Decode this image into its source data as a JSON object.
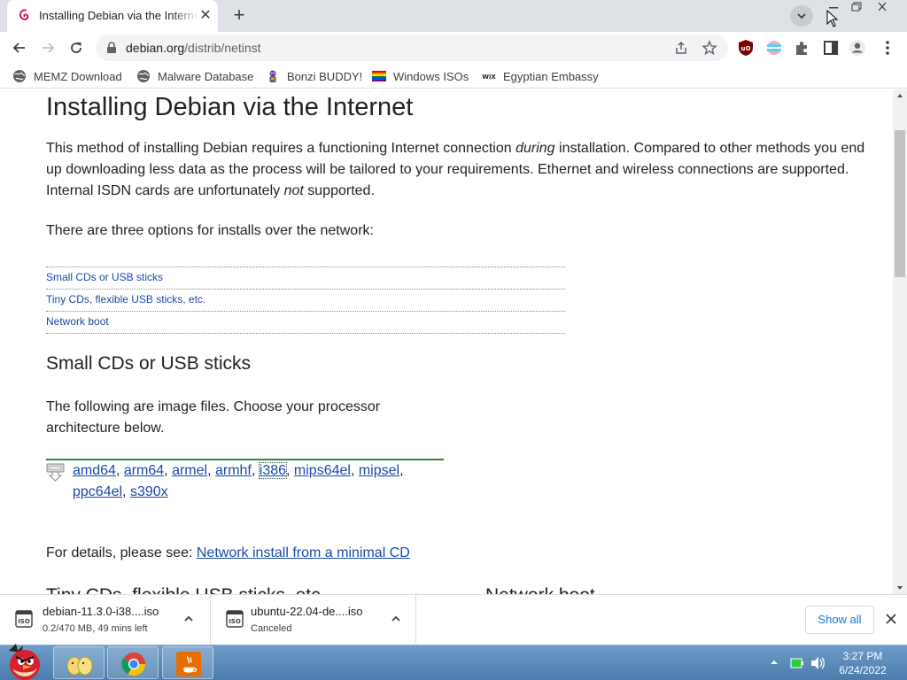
{
  "browser": {
    "tab": {
      "title": "Installing Debian via the Internet",
      "close": "✕"
    },
    "new_tab": "+",
    "url": {
      "host": "debian.org",
      "path": "/distrib/netinst"
    }
  },
  "bookmarks": [
    {
      "label": "MEMZ Download",
      "icon": "globe-icon"
    },
    {
      "label": "Malware Database",
      "icon": "globe-icon"
    },
    {
      "label": "Bonzi BUDDY!",
      "icon": "bonzi-icon"
    },
    {
      "label": "Windows ISOs",
      "icon": "rainbow-flag-icon"
    },
    {
      "label": "Egyptian Embassy",
      "icon": "wix-icon"
    }
  ],
  "page": {
    "title": "Installing Debian via the Internet",
    "intro": {
      "p1": "This method of installing Debian requires a functioning Internet connection ",
      "em1": "during",
      "p2": " installation. Compared to other methods you end up downloading less data as the process will be tailored to your requirements. Ethernet and wireless connections are supported. Internal ISDN cards are unfortunately ",
      "em2": "not",
      "p3": " supported."
    },
    "options_text": "There are three options for installs over the network:",
    "toc": [
      "Small CDs or USB sticks",
      "Tiny CDs, flexible USB sticks, etc.",
      "Network boot"
    ],
    "section_title": "Small CDs or USB sticks",
    "file_text": "The following are image files. Choose your processor architecture below.",
    "architectures": [
      "amd64",
      "arm64",
      "armel",
      "armhf",
      "i386",
      "mips64el",
      "mipsel",
      "ppc64el",
      "s390x"
    ],
    "details_prefix": "For details, please see: ",
    "details_link": "Network install from a minimal CD",
    "next_heading_left": "Tiny CDs, flexible USB sticks, etc.",
    "next_heading_right": "Network boot"
  },
  "downloads": [
    {
      "name": "debian-11.3.0-i38....iso",
      "status": "0.2/470 MB, 49 mins left"
    },
    {
      "name": "ubuntu-22.04-de....iso",
      "status": "Canceled"
    }
  ],
  "show_all": "Show all",
  "taskbar": {
    "time": "3:27 PM",
    "date": "6/24/2022"
  },
  "colors": {
    "link": "#1a4aa8",
    "rule": "#2e8b2e",
    "chrome_accent": "#1a73e8"
  }
}
